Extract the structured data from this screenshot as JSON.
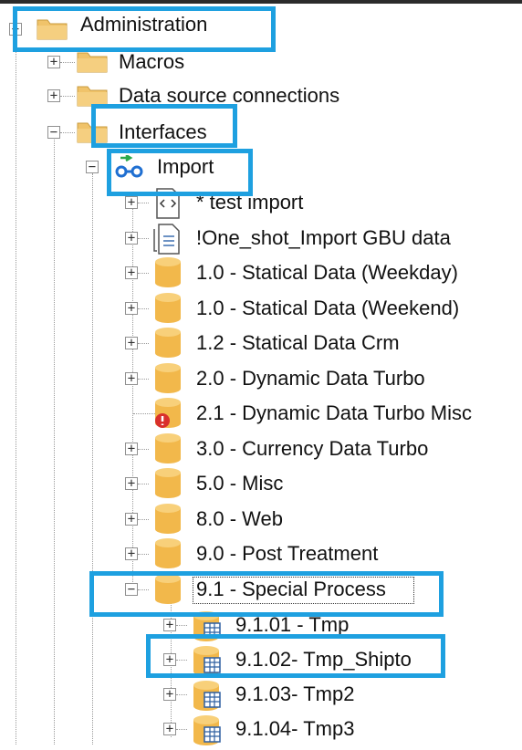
{
  "tree": {
    "root": {
      "label": "Administration"
    },
    "macros": {
      "label": "Macros"
    },
    "data_source_connections": {
      "label": "Data source connections"
    },
    "interfaces": {
      "label": "Interfaces"
    },
    "import": {
      "label": "Import"
    },
    "items": [
      {
        "label": "* test import",
        "icon": "code-file-icon"
      },
      {
        "label": "!One_shot_Import GBU data",
        "icon": "document-icon"
      },
      {
        "label": "1.0 - Statical Data (Weekday)",
        "icon": "database-icon"
      },
      {
        "label": "1.0 - Statical Data (Weekend)",
        "icon": "database-icon"
      },
      {
        "label": "1.2 - Statical Data Crm",
        "icon": "database-icon"
      },
      {
        "label": "2.0 - Dynamic Data Turbo",
        "icon": "database-icon"
      },
      {
        "label": "2.1 - Dynamic Data Turbo Misc",
        "icon": "database-error-icon"
      },
      {
        "label": "3.0 - Currency Data Turbo",
        "icon": "database-icon"
      },
      {
        "label": "5.0 - Misc",
        "icon": "database-icon"
      },
      {
        "label": "8.0 - Web",
        "icon": "database-icon"
      },
      {
        "label": "9.0 - Post Treatment",
        "icon": "database-icon"
      },
      {
        "label": "9.1 - Special Process",
        "icon": "database-icon"
      }
    ],
    "sub_items": [
      {
        "label": "9.1.01 - Tmp",
        "icon": "database-table-icon"
      },
      {
        "label": "9.1.02- Tmp_Shipto",
        "icon": "database-table-icon"
      },
      {
        "label": "9.1.03- Tmp2",
        "icon": "database-table-icon"
      },
      {
        "label": "9.1.04- Tmp3",
        "icon": "database-table-icon"
      }
    ]
  },
  "colors": {
    "highlight": "#1ea0e0",
    "folder": "#f0c36a",
    "database": "#f2b84b",
    "error": "#d9302c",
    "import_arrow_green": "#2aa84a",
    "import_blue": "#1f6fd1"
  }
}
